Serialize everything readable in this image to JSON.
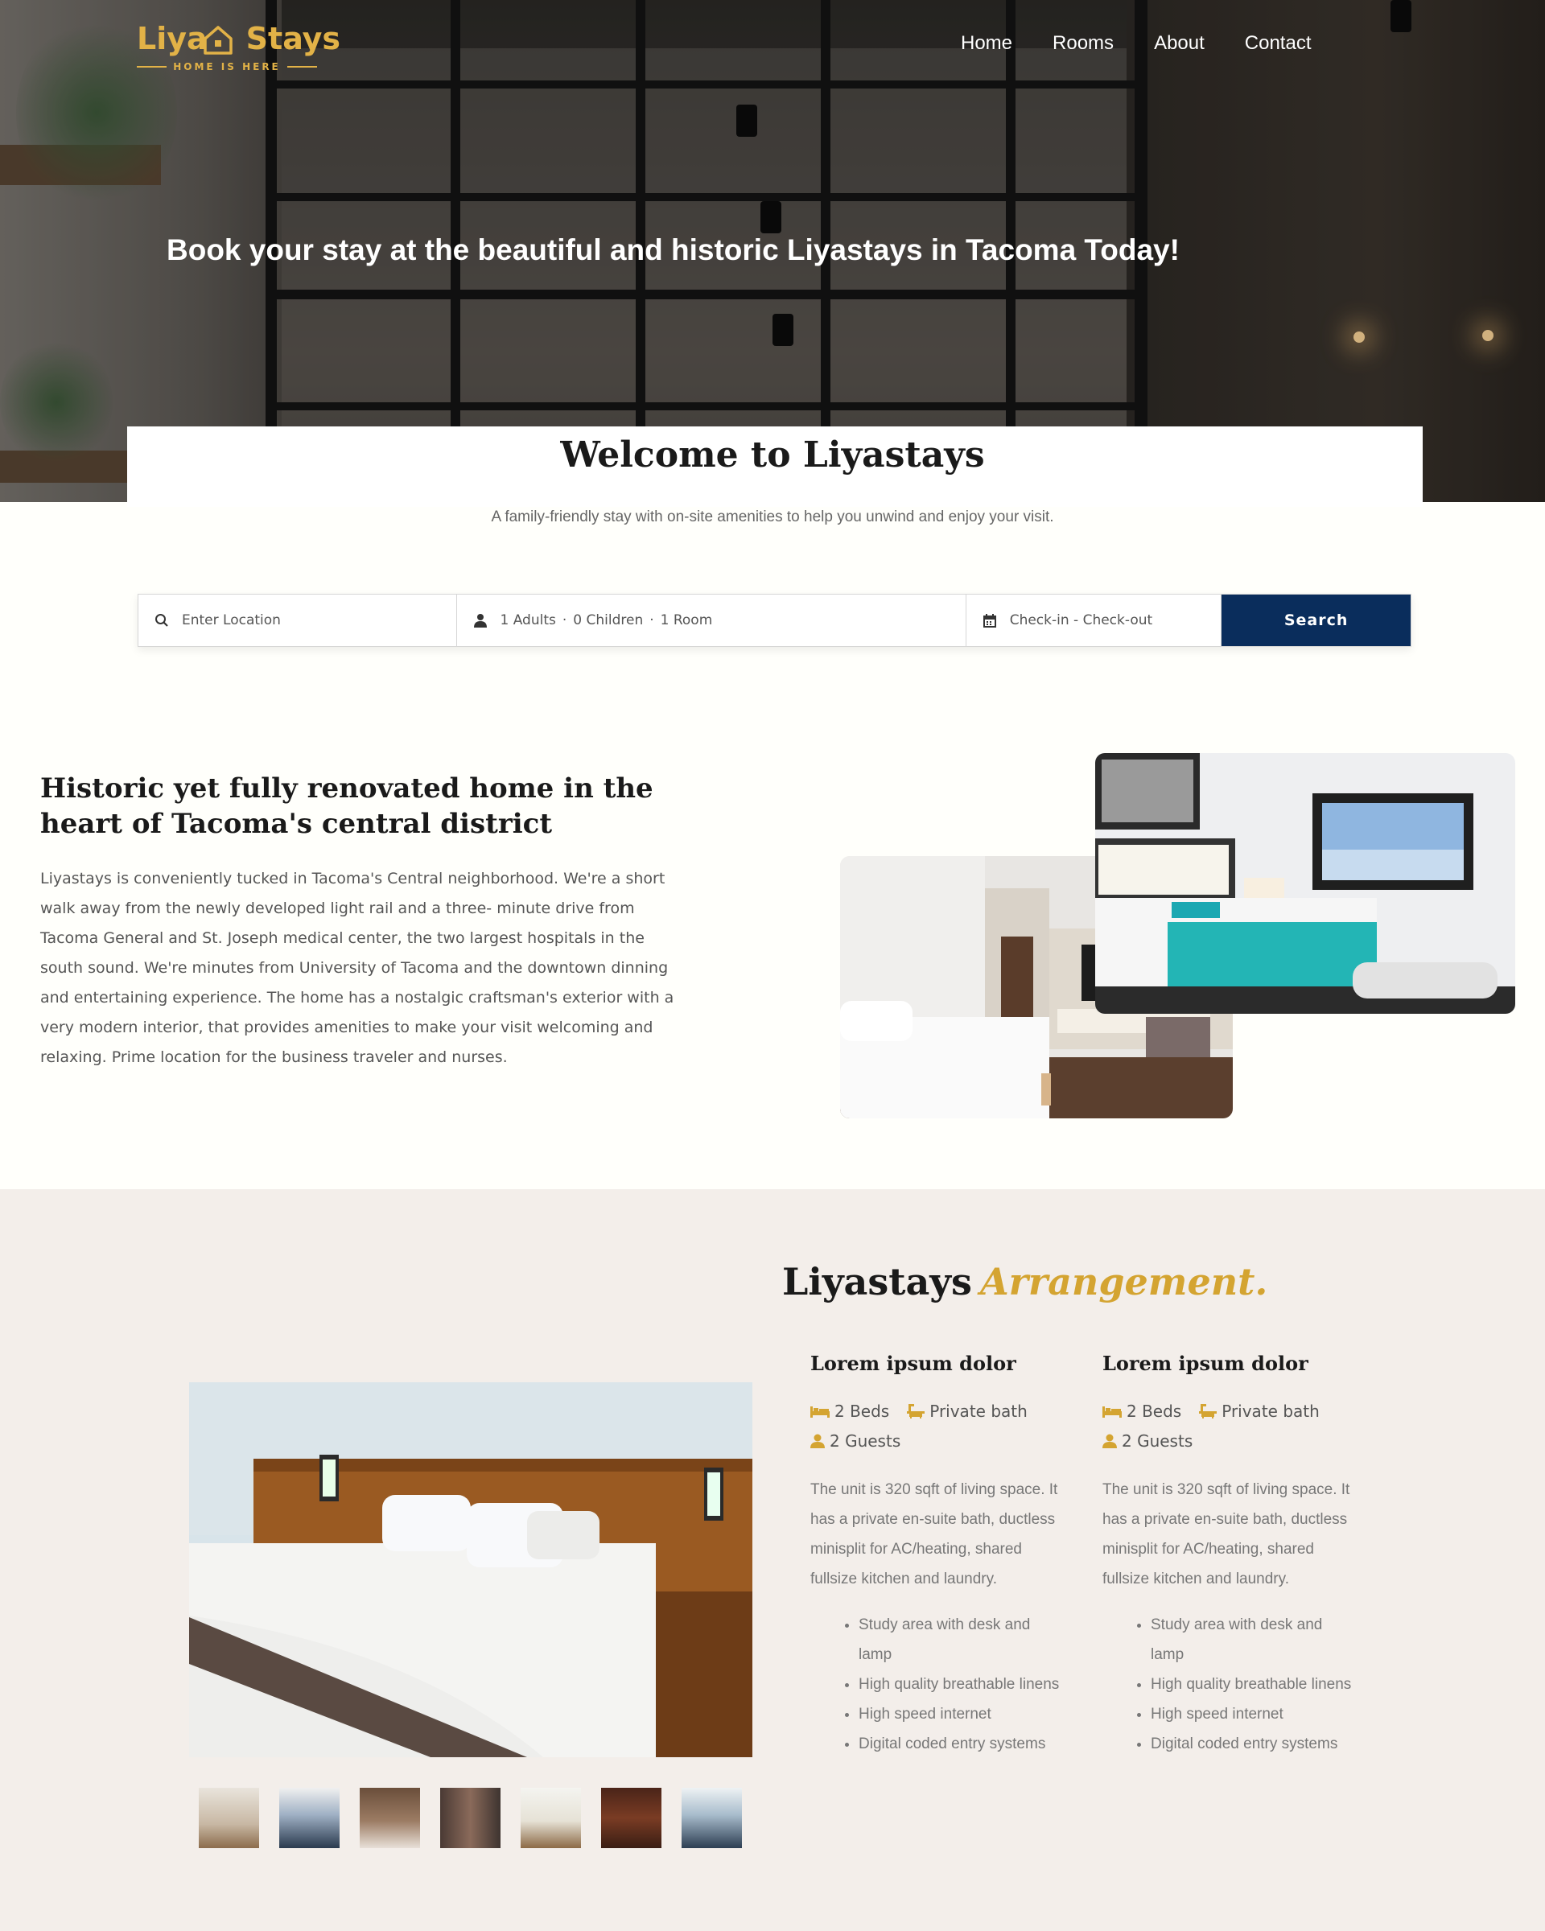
{
  "brand": {
    "name_part1": "Liya",
    "name_part2": "Stays",
    "tagline": "HOME IS HERE",
    "accent_color": "#e2b247"
  },
  "nav": {
    "items": [
      {
        "label": "Home"
      },
      {
        "label": "Rooms"
      },
      {
        "label": "About"
      },
      {
        "label": "Contact"
      }
    ]
  },
  "hero": {
    "title": "Book your stay at the beautiful and historic Liyastays in Tacoma Today!"
  },
  "welcome": {
    "title": "Welcome to Liyastays",
    "subtitle": "A family-friendly stay with on-site amenities to  help you unwind and enjoy your visit."
  },
  "search": {
    "location_placeholder": "Enter Location",
    "guests": {
      "adults": "1 Adults",
      "children": "0 Children",
      "rooms": "1 Room"
    },
    "dates_placeholder": "Check-in - Check-out",
    "button_label": "Search",
    "button_color": "#0a2d5c"
  },
  "about": {
    "title": "Historic yet fully renovated home in the heart of Tacoma's central district",
    "text": "Liyastays is conveniently tucked in Tacoma's Central neighborhood. We're a short walk away from the newly developed light rail and a three- minute drive from Tacoma General and St. Joseph medical center, the two largest hospitals in the south sound. We're minutes from University of Tacoma and the downtown dinning and entertaining experience. The home has a nostalgic craftsman's exterior with a very modern interior, that provides amenities to make your visit welcoming and relaxing. Prime location for the business traveler and nurses."
  },
  "arrangement": {
    "title": "Liyastays",
    "title_accent": "Arrangement.",
    "accent_color": "#d4a431",
    "thumbnail_count": 7,
    "units": [
      {
        "name": "Lorem ipsum dolor",
        "beds": "2 Beds",
        "bath": "Private bath",
        "guests": "2 Guests",
        "description": "The unit is 320 sqft of living space. It has a private en-suite bath,  ductless minisplit for AC/heating, shared fullsize kitchen and laundry.",
        "amenities": [
          "Study area with desk and lamp",
          "High quality  breathable linens",
          "High speed internet",
          "Digital coded entry systems"
        ]
      },
      {
        "name": "Lorem ipsum dolor",
        "beds": "2 Beds",
        "bath": "Private bath",
        "guests": "2 Guests",
        "description": "The unit is 320 sqft of living space. It has a private en-suite bath,  ductless minisplit for AC/heating, shared fullsize kitchen and laundry.",
        "amenities": [
          "Study area with desk and lamp",
          "High quality  breathable linens",
          "High speed internet",
          "Digital coded entry systems"
        ]
      }
    ]
  }
}
